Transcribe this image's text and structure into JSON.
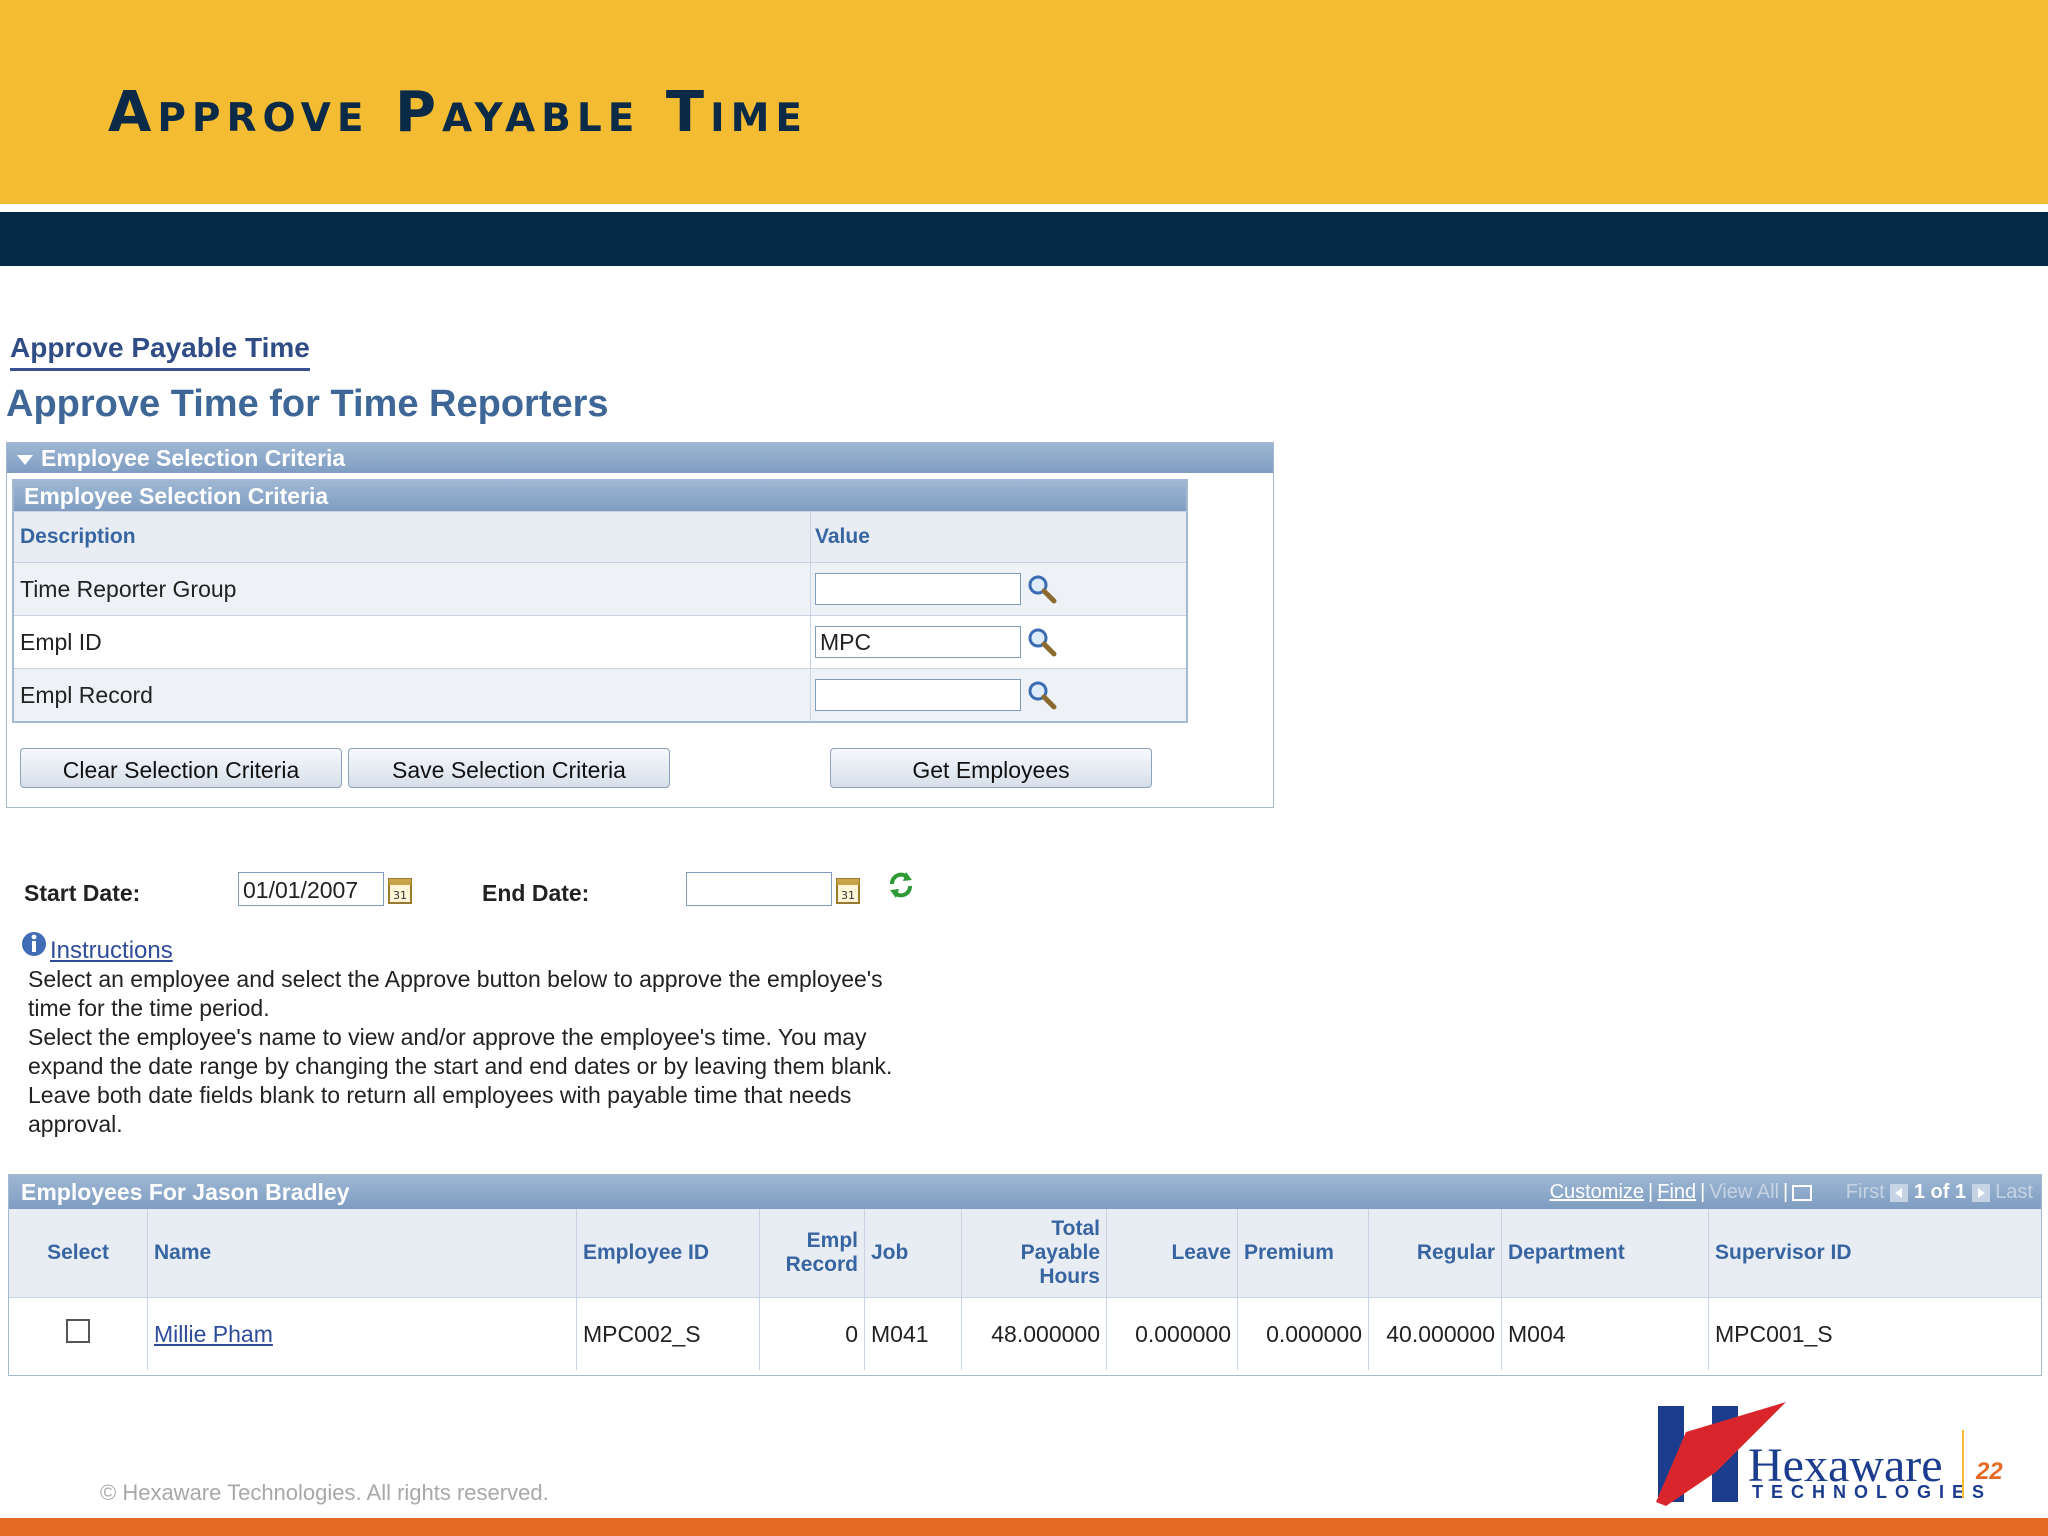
{
  "slide": {
    "title": "Approve Payable Time",
    "footer": "© Hexaware Technologies. All rights reserved.",
    "page_number": "22",
    "logo_name": "Hexaware",
    "logo_sub": "TECHNOLOGIES"
  },
  "breadcrumb": "Approve Payable Time",
  "page_title": "Approve Time for Time Reporters",
  "criteria": {
    "panel_title": "Employee Selection Criteria",
    "grid_title": "Employee Selection Criteria",
    "col_description": "Description",
    "col_value": "Value",
    "rows": [
      {
        "label": "Time Reporter Group",
        "value": ""
      },
      {
        "label": "Empl ID",
        "value": "MPC"
      },
      {
        "label": "Empl Record",
        "value": ""
      }
    ],
    "buttons": {
      "clear": "Clear Selection Criteria",
      "save": "Save Selection Criteria",
      "get": "Get Employees"
    }
  },
  "dates": {
    "start_label": "Start Date:",
    "start_value": "01/01/2007",
    "end_label": "End Date:",
    "end_value": ""
  },
  "instructions": {
    "link": "Instructions",
    "line1": "Select an employee and select the Approve button below to approve the employee's time for the time period.",
    "line2": "Select the employee's name to view and/or approve the employee's time.  You may expand the date range by changing the start and end dates or by leaving them blank.  Leave both date fields blank to return all employees with payable time that needs approval."
  },
  "employees": {
    "title": "Employees For Jason Bradley",
    "nav": {
      "customize": "Customize",
      "find": "Find",
      "view_all": "View All",
      "first": "First",
      "count": "1 of 1",
      "last": "Last"
    },
    "columns": {
      "select": "Select",
      "name": "Name",
      "employee_id": "Employee ID",
      "empl_record": "Empl Record",
      "job": "Job",
      "total_hours": "Total Payable Hours",
      "leave": "Leave",
      "premium": "Premium",
      "regular": "Regular",
      "department": "Department",
      "supervisor_id": "Supervisor ID"
    },
    "rows": [
      {
        "selected": false,
        "name": "Millie Pham",
        "employee_id": "MPC002_S",
        "empl_record": "0",
        "job": "M041",
        "total_hours": "48.000000",
        "leave": "0.000000",
        "premium": "0.000000",
        "regular": "40.000000",
        "department": "M004",
        "supervisor_id": "MPC001_S"
      }
    ]
  },
  "colors": {
    "header_yellow": "#F4BC32",
    "band_navy": "#042946",
    "bottom_orange": "#E56B24",
    "grid_header_blue": "#7F9DC2",
    "link_blue": "#2F4C9A"
  }
}
